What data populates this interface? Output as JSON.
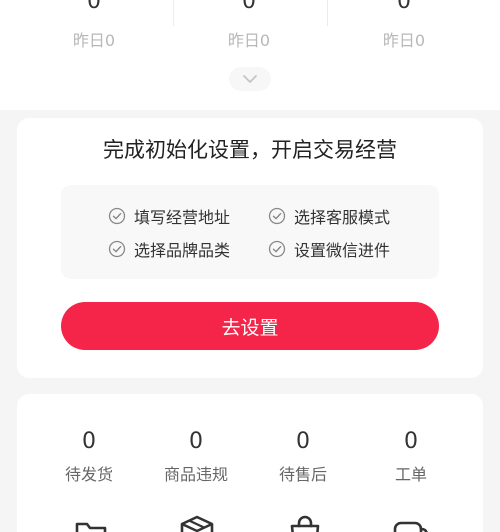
{
  "top_stats": [
    {
      "value": "0",
      "yesterday": "昨日0"
    },
    {
      "value": "0",
      "yesterday": "昨日0"
    },
    {
      "value": "0",
      "yesterday": "昨日0"
    }
  ],
  "setup": {
    "title": "完成初始化设置，开启交易经营",
    "tasks": [
      {
        "label": "填写经营地址"
      },
      {
        "label": "选择客服模式"
      },
      {
        "label": "选择品牌品类"
      },
      {
        "label": "设置微信进件"
      }
    ],
    "button_label": "去设置"
  },
  "orders": [
    {
      "value": "0",
      "label": "待发货"
    },
    {
      "value": "0",
      "label": "商品违规"
    },
    {
      "value": "0",
      "label": "待售后"
    },
    {
      "value": "0",
      "label": "工单"
    }
  ],
  "shortcuts": [
    {
      "icon": "folder-icon"
    },
    {
      "icon": "box-icon"
    },
    {
      "icon": "bag-icon"
    },
    {
      "icon": "chat-icon"
    }
  ],
  "colors": {
    "accent": "#f5254a",
    "background": "#f5f5f5",
    "card": "#ffffff"
  }
}
